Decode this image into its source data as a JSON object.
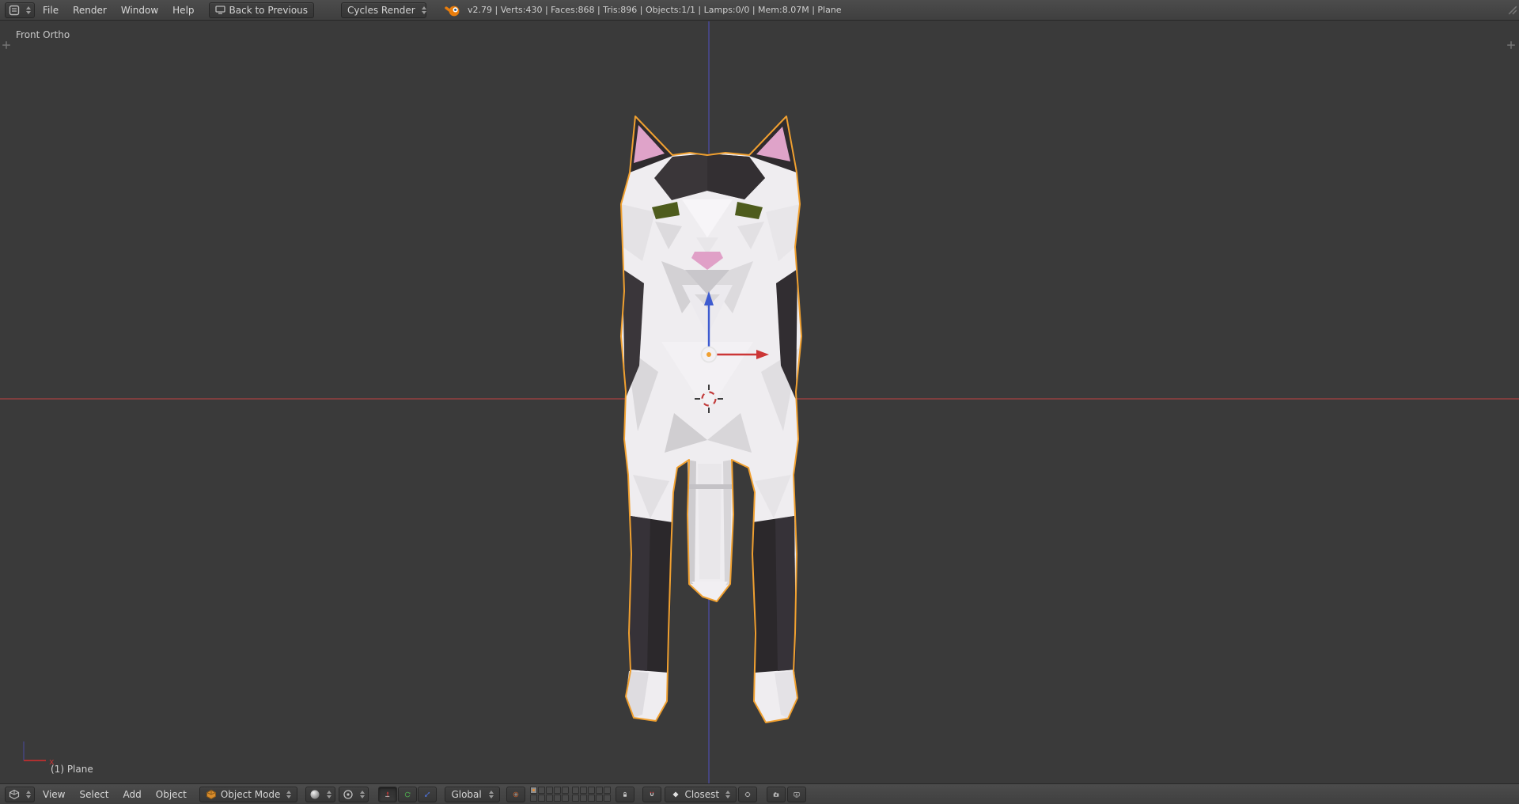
{
  "colors": {
    "selection_outline": "#f0a030",
    "axis_x_red": "#8c4040",
    "axis_z_blue": "#4a4a96",
    "viewport_background": "#3a3a3a"
  },
  "top_header": {
    "menus": [
      "File",
      "Render",
      "Window",
      "Help"
    ],
    "back_button_label": "Back to Previous",
    "engine_selector": "Cycles Render",
    "stats": "v2.79 | Verts:430 | Faces:868 | Tris:896 | Objects:1/1 | Lamps:0/0 | Mem:8.07M | Plane"
  },
  "viewport": {
    "view_label": "Front Ortho",
    "active_object_label": "(1) Plane",
    "mini_axis_x_label": "x"
  },
  "footer": {
    "menus": [
      "View",
      "Select",
      "Add",
      "Object"
    ],
    "mode_selector": "Object Mode",
    "orientation_selector": "Global",
    "snap_element_selector": "Closest"
  }
}
